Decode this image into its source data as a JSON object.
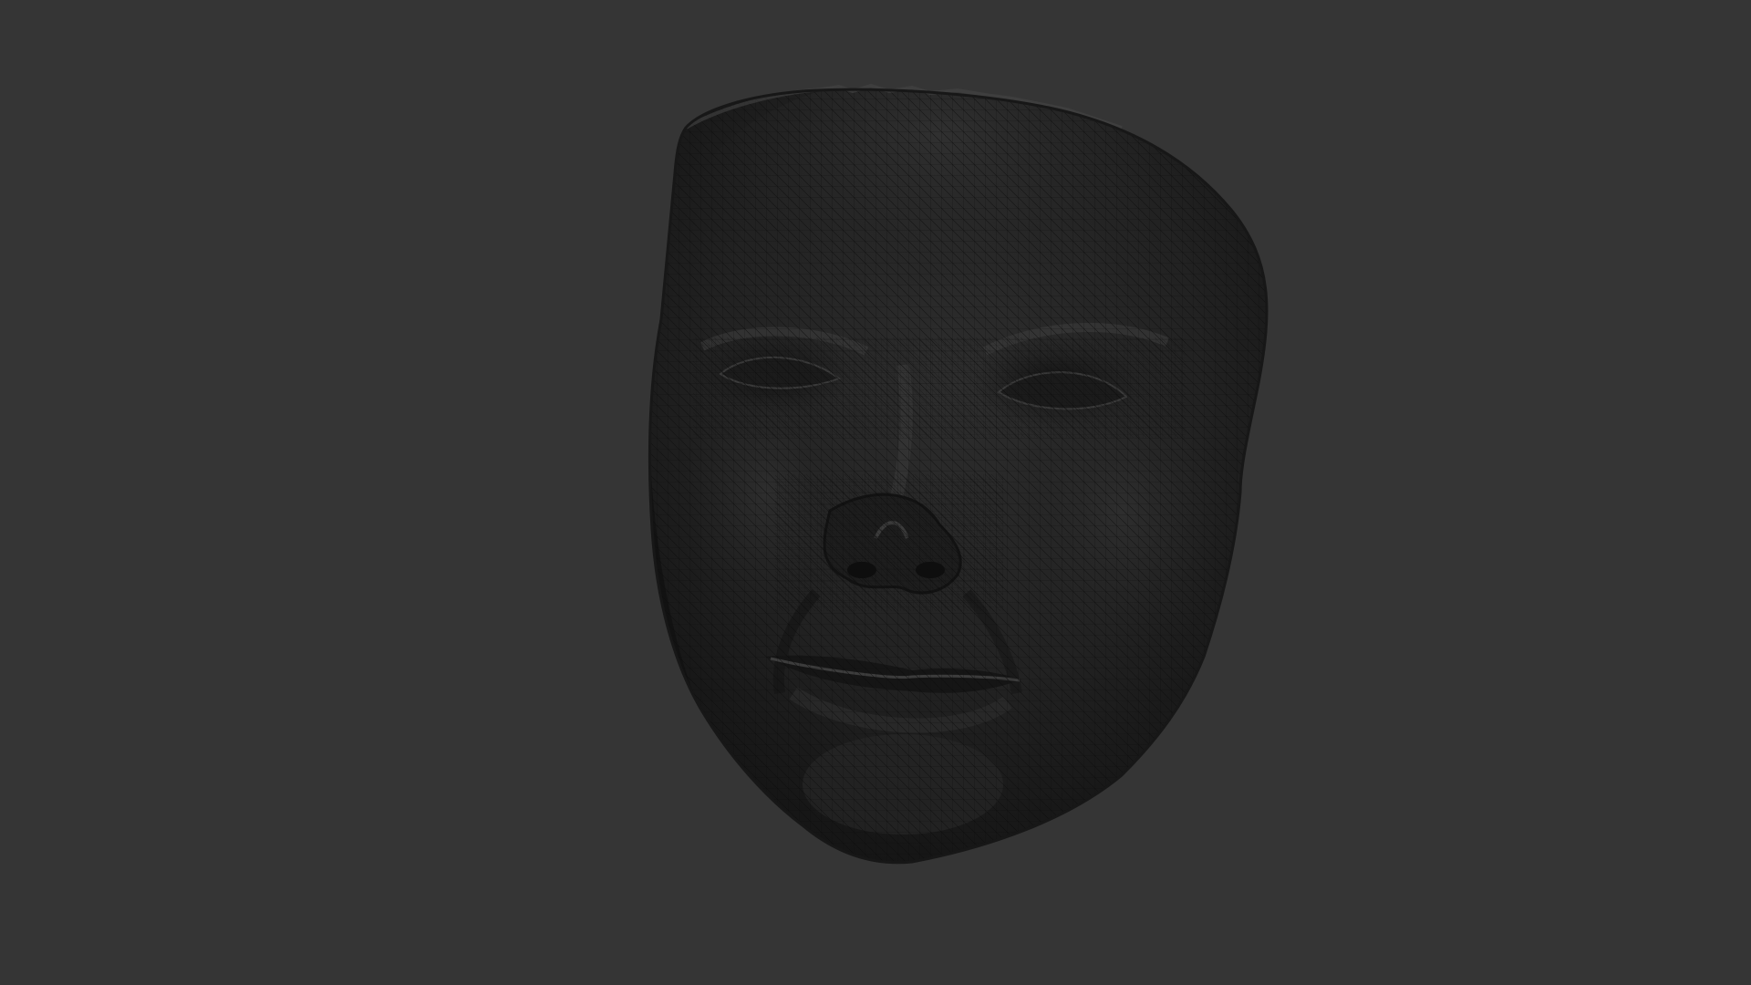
{
  "viewport": {
    "background_color": "#353535",
    "mesh_shade_color": "#1e1e1e",
    "mesh_wire_color": "#0a0a0a",
    "highlight_color": "#4a4a4a",
    "subject": "face-mesh"
  }
}
